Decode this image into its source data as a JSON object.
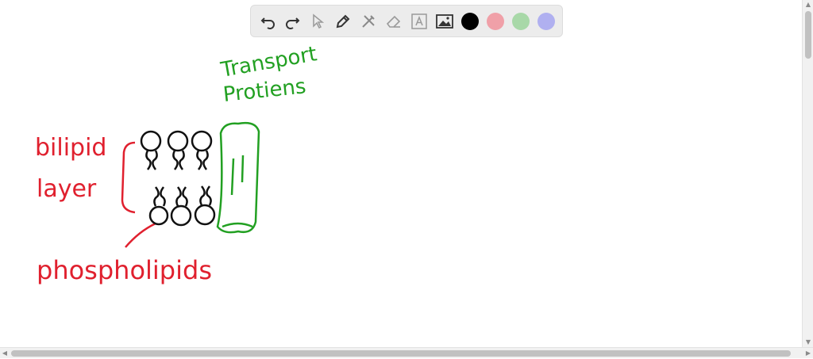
{
  "toolbar": {
    "tools": [
      "undo-icon",
      "redo-icon",
      "pointer-icon",
      "pen-icon",
      "tools-icon",
      "eraser-icon",
      "text-icon",
      "image-icon"
    ],
    "colors": [
      "#000000",
      "#f0a0a8",
      "#a8d8a8",
      "#b0b0f0"
    ]
  },
  "canvas": {
    "labels": {
      "transport_line1": "Transport",
      "transport_line2": "Protiens",
      "bilipid": "bilipid",
      "layer": "layer",
      "phospholipids": "phospholipids"
    },
    "ink_colors": {
      "red": "#e0202e",
      "green": "#22a022",
      "black": "#111111"
    }
  }
}
